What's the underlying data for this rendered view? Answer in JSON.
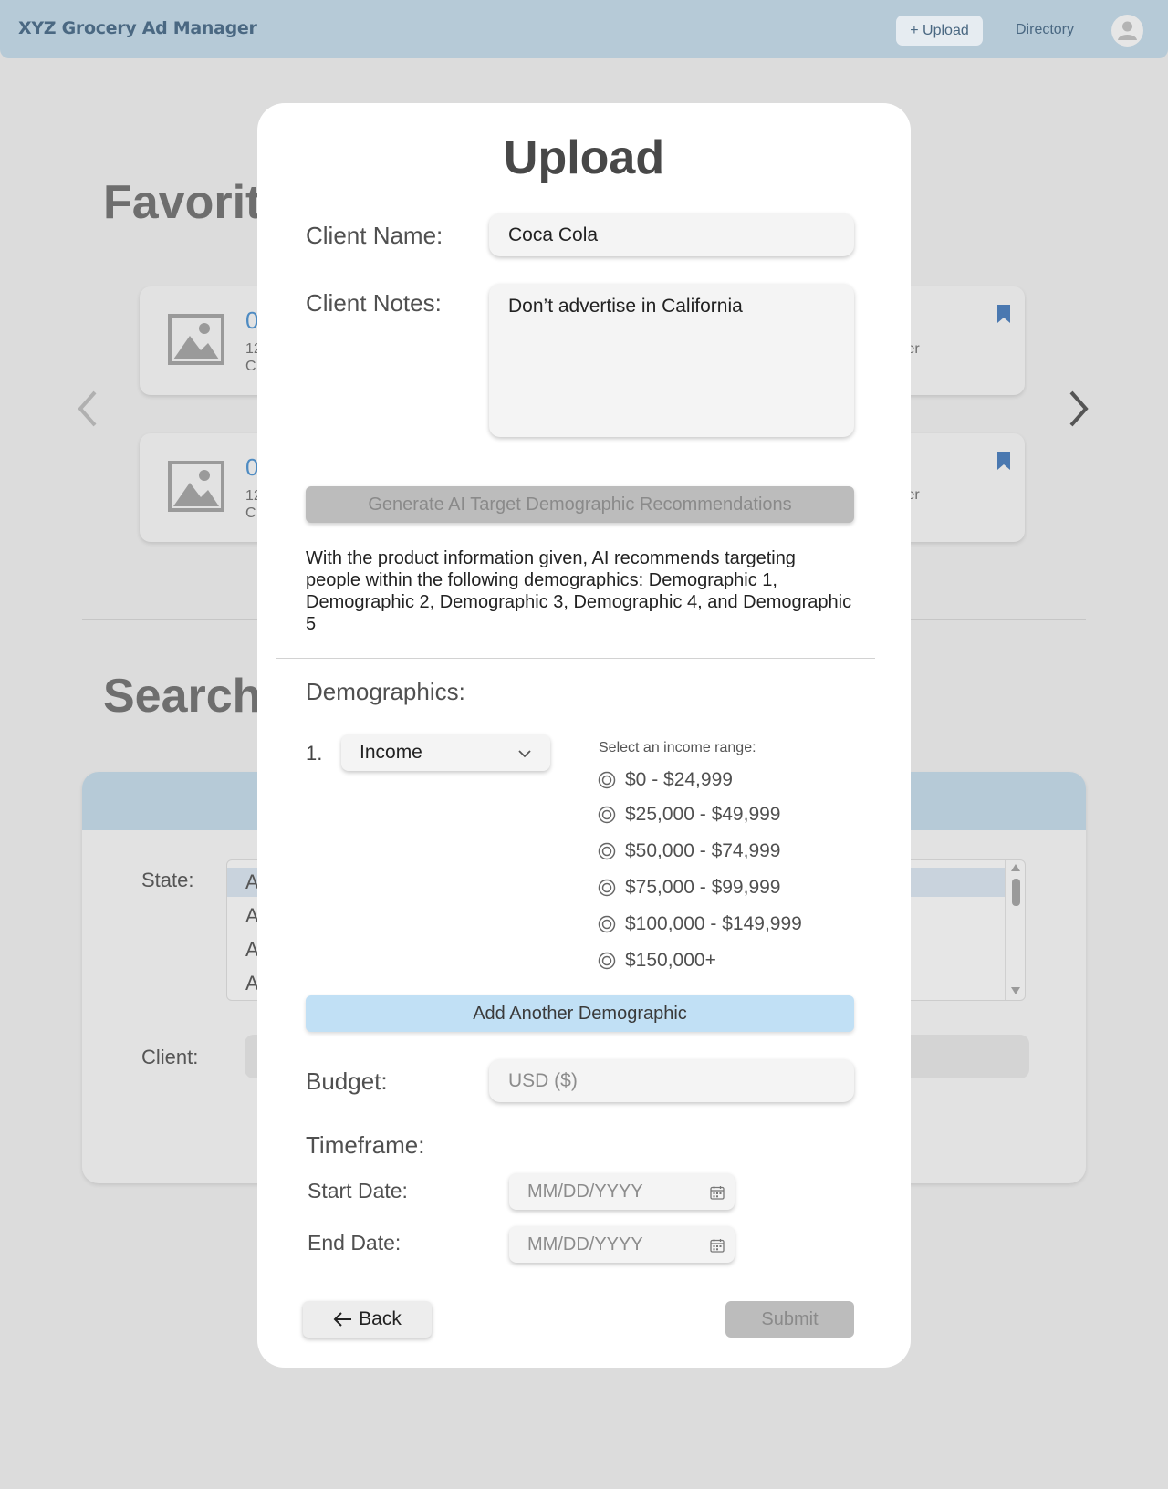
{
  "header": {
    "brand": "XYZ Grocery Ad Manager",
    "upload_label": "+ Upload",
    "directory_label": "Directory"
  },
  "background": {
    "favorites_heading": "Favorit",
    "search_heading": "Search",
    "cards": [
      {
        "number_fragment": "0",
        "line1_fragment": "12",
        "line2_fragment": "C",
        "folder_fragment": "lder"
      },
      {
        "number_fragment": "0",
        "line1_fragment": "12",
        "line2_fragment": "C",
        "folder_fragment": "lder"
      }
    ],
    "state_label": "State:",
    "client_label": "Client:",
    "state_rows": [
      "A",
      "A",
      "A",
      "A"
    ]
  },
  "modal": {
    "title": "Upload",
    "client_name_label": "Client Name:",
    "client_name_value": "Coca Cola",
    "client_notes_label": "Client Notes:",
    "client_notes_value": "Don’t advertise in California",
    "generate_button": "Generate AI Target Demographic Recommendations",
    "ai_recommendation": "With the product information given, AI recommends targeting people within the following demographics: Demographic 1, Demographic 2, Demographic 3, Demographic 4, and Demographic 5",
    "demographics_label": "Demographics:",
    "demographic_number": "1.",
    "demographic_selected": "Income",
    "income_prompt": "Select an income range:",
    "income_ranges": [
      "$0 - $24,999",
      "$25,000 - $49,999",
      "$50,000 - $74,999",
      "$75,000 - $99,999",
      "$100,000 - $149,999",
      "$150,000+"
    ],
    "add_demographic_button": "Add Another Demographic",
    "budget_label": "Budget:",
    "budget_placeholder": "USD ($)",
    "timeframe_label": "Timeframe:",
    "start_date_label": "Start Date:",
    "start_date_placeholder": "MM/DD/YYYY",
    "end_date_label": "End Date:",
    "end_date_placeholder": "MM/DD/YYYY",
    "back_button": "Back",
    "submit_button": "Submit"
  },
  "icons": {
    "avatar": "user-avatar-icon",
    "image_placeholder": "image-icon",
    "bookmark": "bookmark-icon",
    "carousel_prev": "chevron-left-icon",
    "carousel_next": "chevron-right-icon",
    "dropdown": "chevron-down-icon",
    "calendar": "calendar-icon",
    "back_arrow": "arrow-left-icon",
    "radio": "radio-icon"
  },
  "colors": {
    "header_bg": "#b6cad7",
    "brand_text": "#4a6882",
    "link_blue": "#4e8bc2",
    "add_button_bg": "#c1e0f5",
    "disabled_button_bg": "#bcbcbc"
  }
}
